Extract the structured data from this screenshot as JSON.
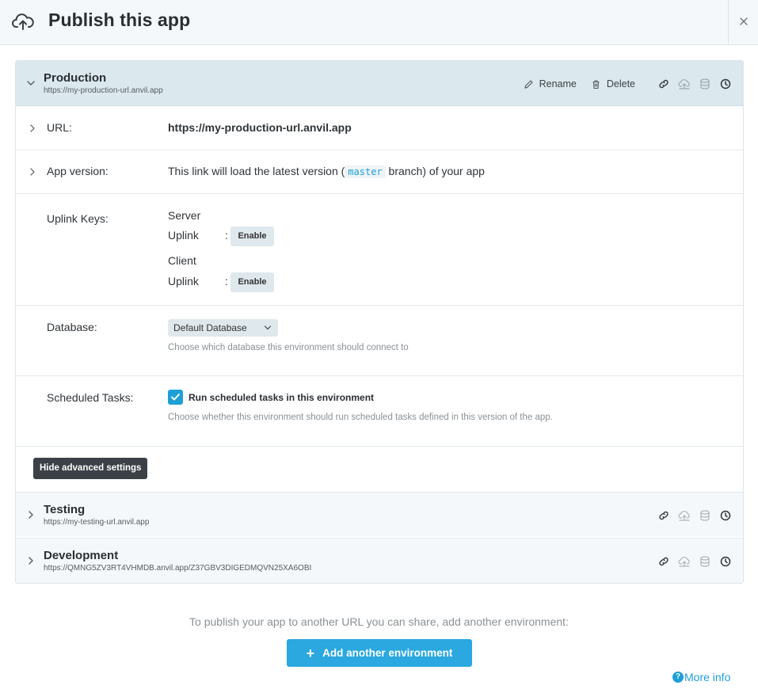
{
  "header": {
    "title": "Publish this app",
    "close_icon": "close-icon",
    "upload_icon": "cloud-upload-icon"
  },
  "production": {
    "name": "Production",
    "url": "https://my-production-url.anvil.app",
    "rename_label": "Rename",
    "delete_label": "Delete",
    "rows": {
      "url_label": "URL:",
      "url_value": "https://my-production-url.anvil.app",
      "version_label": "App version:",
      "version_prefix": "This link will load the latest version (",
      "version_branch": "master",
      "version_suffix": " branch) of your app",
      "uplink_label": "Uplink Keys:",
      "server_label": "Server",
      "client_label": "Client",
      "uplink_word": "Uplink",
      "colon": ":",
      "enable_label": "Enable",
      "database_label": "Database:",
      "database_selected": "Default Database",
      "database_hint": "Choose which database this environment should connect to",
      "tasks_label": "Scheduled Tasks:",
      "tasks_checkbox_label": "Run scheduled tasks in this environment",
      "tasks_checked": true,
      "tasks_hint": "Choose whether this environment should run scheduled tasks defined in this version of the app."
    }
  },
  "hide_advanced_label": "Hide advanced settings",
  "testing": {
    "name": "Testing",
    "url": "https://my-testing-url.anvil.app"
  },
  "development": {
    "name": "Development",
    "url": "https://QMNG5ZV3RT4VHMDB.anvil.app/Z37GBV3DIGEDMQVN25XA6OBI"
  },
  "footer": {
    "text": "To publish your app to another URL you can share, add another environment:",
    "add_label": "Add another environment",
    "more_info_label": "More info"
  },
  "colors": {
    "accent": "#1e9fd6",
    "active_header": "#dbe9ee"
  }
}
